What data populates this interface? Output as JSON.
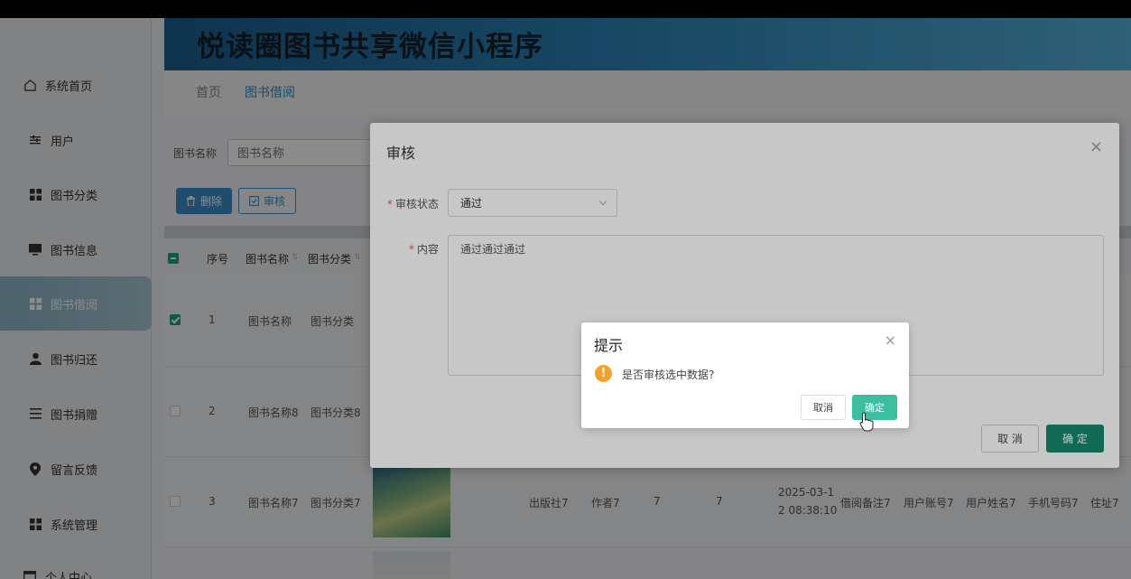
{
  "app": {
    "title": "悦读圈图书共享微信小程序"
  },
  "sidebar": {
    "items": [
      {
        "label": "系统首页",
        "icon": "home-icon"
      },
      {
        "label": "用户",
        "icon": "sliders-icon"
      },
      {
        "label": "图书分类",
        "icon": "grid-icon"
      },
      {
        "label": "图书信息",
        "icon": "monitor-icon"
      },
      {
        "label": "图书借阅",
        "icon": "grid-icon",
        "active": true
      },
      {
        "label": "图书归还",
        "icon": "person-icon"
      },
      {
        "label": "图书捐赠",
        "icon": "list-icon"
      },
      {
        "label": "留言反馈",
        "icon": "location-icon"
      },
      {
        "label": "系统管理",
        "icon": "grid-icon"
      },
      {
        "label": "个人中心",
        "icon": "window-icon"
      }
    ]
  },
  "breadcrumb": {
    "home": "首页",
    "current": "图书借阅"
  },
  "search": {
    "label": "图书名称",
    "placeholder": "图书名称"
  },
  "toolbar": {
    "delete_label": "删除",
    "audit_label": "审核"
  },
  "table": {
    "headers": [
      "序号",
      "图书名称",
      "图书分类"
    ],
    "rows": [
      {
        "index": "1",
        "name": "图书名称",
        "category": "图书分类",
        "checked": true
      },
      {
        "index": "2",
        "name": "图书名称8",
        "category": "图书分类8",
        "checked": false
      },
      {
        "index": "3",
        "name": "图书名称7",
        "category": "图书分类7",
        "publisher": "出版社7",
        "author": "作者7",
        "qty1": "7",
        "qty2": "7",
        "datetime": "2025-03-12 08:38:10",
        "datetime_line1": "2025-03-1",
        "datetime_line2": "2 08:38:10",
        "remark": "借阅备注7",
        "account": "用户账号7",
        "username": "用户姓名7",
        "phone": "手机号码7",
        "address": "住址7",
        "checked": false
      }
    ]
  },
  "audit_dialog": {
    "title": "审核",
    "status_label": "审核状态",
    "status_value": "通过",
    "content_label": "内容",
    "content_value": "通过通过通过",
    "cancel_label": "取 消",
    "ok_label": "确 定"
  },
  "confirm": {
    "title": "提示",
    "message": "是否审核选中数据?",
    "cancel_label": "取消",
    "ok_label": "确定"
  },
  "colors": {
    "accent": "#3d8fc9",
    "ok": "#178a6c",
    "confirm_ok": "#3cbf9f",
    "warn": "#f0a22d"
  }
}
